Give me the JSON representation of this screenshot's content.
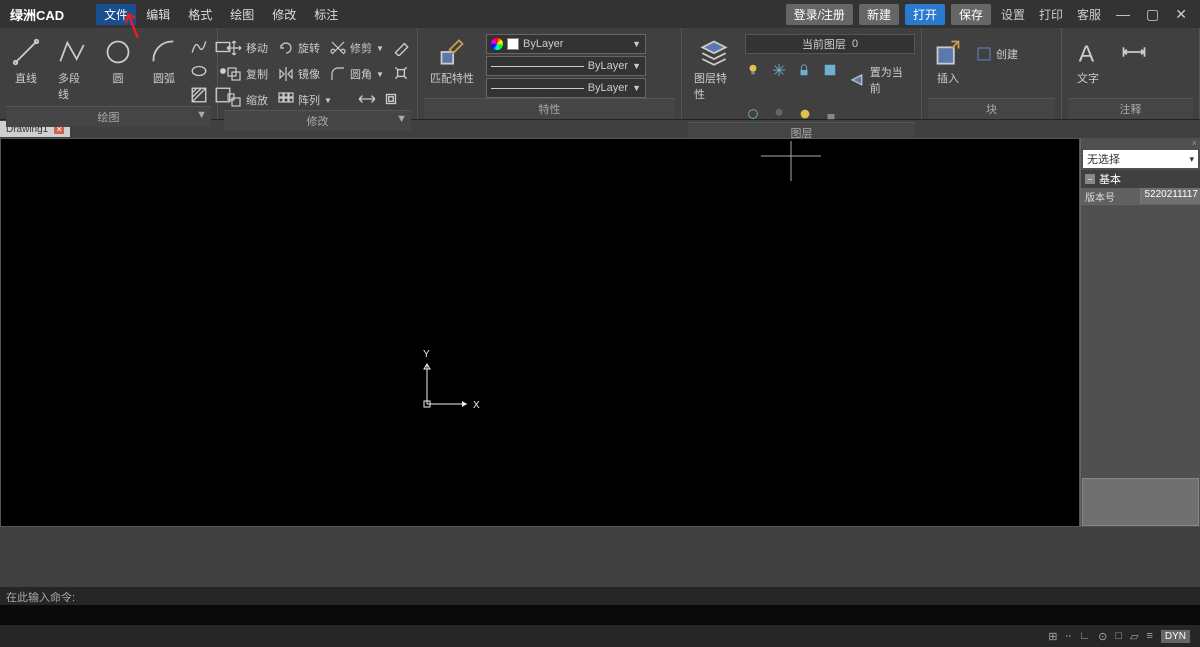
{
  "app": {
    "title": "绿洲CAD"
  },
  "menu": {
    "items": [
      "文件",
      "编辑",
      "格式",
      "绘图",
      "修改",
      "标注"
    ],
    "active_index": 0
  },
  "menubar_right": {
    "login": "登录/注册",
    "new": "新建",
    "open": "打开",
    "save": "保存",
    "settings": "设置",
    "print": "打印",
    "service": "客服"
  },
  "ribbon": {
    "draw": {
      "label": "绘图",
      "line": "直线",
      "polyline": "多段线",
      "circle": "圆",
      "arc": "圆弧"
    },
    "modify": {
      "label": "修改",
      "move": "移动",
      "rotate": "旋转",
      "trim": "修剪",
      "copy": "复制",
      "mirror": "镜像",
      "fillet": "圆角",
      "scale": "缩放",
      "array": "阵列"
    },
    "match": {
      "label": "特性",
      "match": "匹配特性"
    },
    "properties": {
      "color": "ByLayer",
      "linetype": "ByLayer",
      "lineweight": "ByLayer"
    },
    "layer": {
      "label": "图层",
      "panel": "图层特性",
      "current_label": "当前图层",
      "current_value": "0",
      "set_current": "置为当前"
    },
    "block": {
      "label": "块",
      "insert": "插入",
      "create": "创建"
    },
    "annotate": {
      "label": "注释",
      "text": "文字"
    }
  },
  "tabs": {
    "doc": "Drawing1"
  },
  "ucs": {
    "x": "X",
    "y": "Y"
  },
  "props": {
    "select": "无选择",
    "group": "基本",
    "version_key": "版本号",
    "version_val": "5220211117"
  },
  "cmdline": {
    "prompt": "在此输入命令:"
  },
  "status": {
    "dyn": "DYN"
  }
}
